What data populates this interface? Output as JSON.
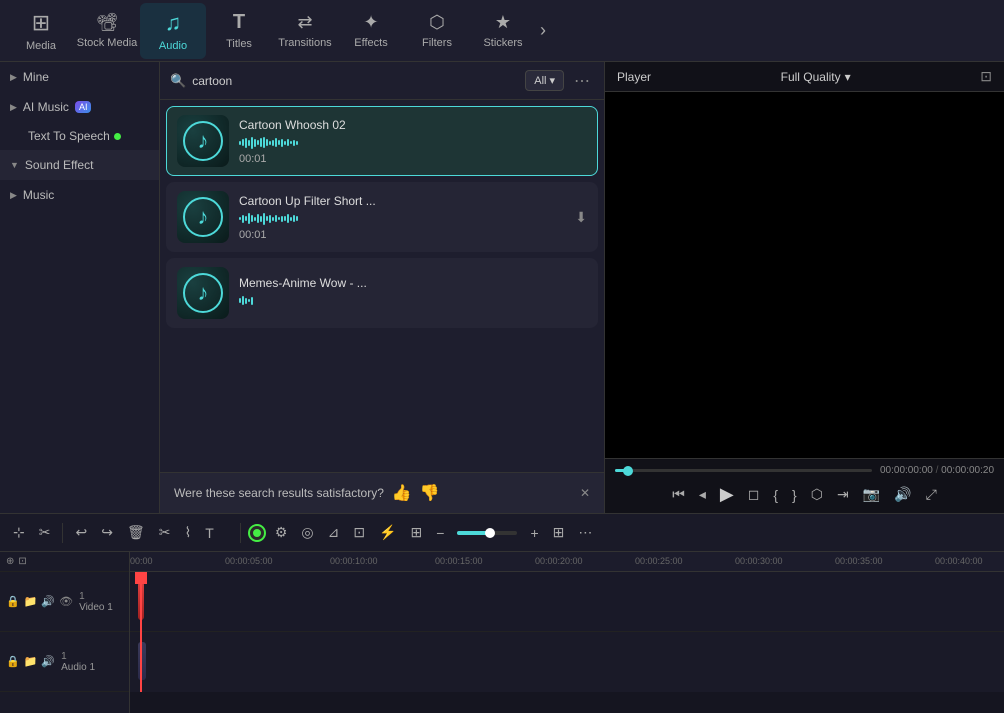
{
  "toolbar": {
    "items": [
      {
        "id": "media",
        "label": "Media",
        "icon": "⊞",
        "active": false
      },
      {
        "id": "stock-media",
        "label": "Stock Media",
        "icon": "🎞",
        "active": false
      },
      {
        "id": "audio",
        "label": "Audio",
        "icon": "♪",
        "active": true
      },
      {
        "id": "titles",
        "label": "Titles",
        "icon": "T",
        "active": false
      },
      {
        "id": "transitions",
        "label": "Transitions",
        "icon": "⇄",
        "active": false
      },
      {
        "id": "effects",
        "label": "Effects",
        "icon": "✦",
        "active": false
      },
      {
        "id": "filters",
        "label": "Filters",
        "icon": "◈",
        "active": false
      },
      {
        "id": "stickers",
        "label": "Stickers",
        "icon": "★",
        "active": false
      }
    ]
  },
  "left_panel": {
    "sections": [
      {
        "id": "mine",
        "label": "Mine",
        "has_arrow": true,
        "badge": null,
        "dot": null
      },
      {
        "id": "ai-music",
        "label": "AI Music",
        "has_arrow": true,
        "badge": "AI",
        "dot": null
      },
      {
        "id": "text-to-speech",
        "label": "Text To Speech",
        "has_arrow": false,
        "badge": null,
        "dot": "green",
        "is_sub": true
      },
      {
        "id": "sound-effect",
        "label": "Sound Effect",
        "has_arrow": true,
        "badge": null,
        "dot": null
      },
      {
        "id": "music",
        "label": "Music",
        "has_arrow": true,
        "badge": null,
        "dot": null
      }
    ]
  },
  "search": {
    "value": "cartoon",
    "placeholder": "Search",
    "filter_label": "All"
  },
  "audio_items": [
    {
      "id": "cartoon-whoosh-02",
      "title": "Cartoon Whoosh 02",
      "duration": "00:01",
      "selected": true,
      "has_download": false
    },
    {
      "id": "cartoon-up-filter",
      "title": "Cartoon Up Filter Short ...",
      "duration": "00:01",
      "selected": false,
      "has_download": true
    },
    {
      "id": "memes-anime-wow",
      "title": "Memes-Anime Wow - ...",
      "duration": "",
      "selected": false,
      "has_download": false
    }
  ],
  "feedback": {
    "text": "Were these search results satisfactory?"
  },
  "player": {
    "label": "Player",
    "quality": "Full Quality",
    "current_time": "00:00:00:00",
    "total_time": "00:00:00:20"
  },
  "timeline": {
    "tracks": [
      {
        "id": "video-1",
        "type": "video",
        "label": "Video 1",
        "num": "1"
      },
      {
        "id": "audio-1",
        "type": "audio",
        "label": "Audio 1",
        "num": "1"
      }
    ],
    "ruler_marks": [
      "00:00",
      "00:00:05:00",
      "00:00:10:00",
      "00:00:15:00",
      "00:00:20:00",
      "00:00:25:00",
      "00:00:30:00",
      "00:00:35:00",
      "00:00:40:00"
    ]
  }
}
